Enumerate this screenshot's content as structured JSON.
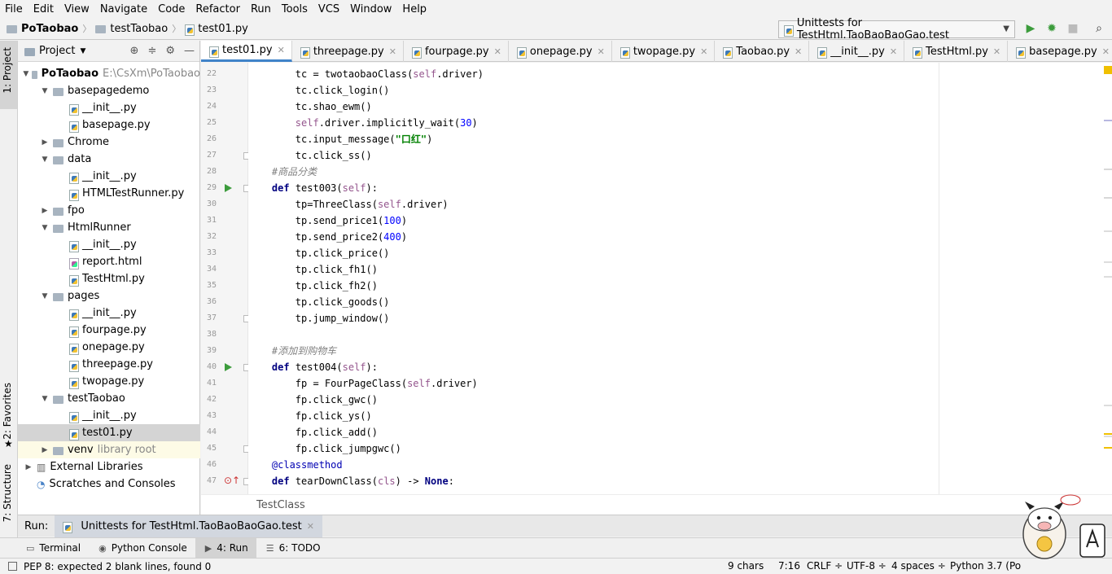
{
  "menu": [
    "File",
    "Edit",
    "View",
    "Navigate",
    "Code",
    "Refactor",
    "Run",
    "Tools",
    "VCS",
    "Window",
    "Help"
  ],
  "nav": {
    "project": "PoTaobao",
    "folder": "testTaobao",
    "file": "test01.py"
  },
  "run_config": "Unittests for TestHtml.TaoBaoBaoGao.test",
  "side_tabs": {
    "project": "1: Project",
    "favorites": "2: Favorites",
    "structure": "7: Structure"
  },
  "project_panel": {
    "title": "Project",
    "tree": [
      {
        "label": "PoTaobao",
        "extra": "E:\\CsXm\\PoTaobao",
        "kind": "folder",
        "depth": 0,
        "expanded": true,
        "bold": true
      },
      {
        "label": "basepagedemo",
        "kind": "folder",
        "depth": 1,
        "expanded": true
      },
      {
        "label": "__init__.py",
        "kind": "py",
        "depth": 2
      },
      {
        "label": "basepage.py",
        "kind": "py",
        "depth": 2
      },
      {
        "label": "Chrome",
        "kind": "folder",
        "depth": 1,
        "expanded": false
      },
      {
        "label": "data",
        "kind": "folder",
        "depth": 1,
        "expanded": true
      },
      {
        "label": "__init__.py",
        "kind": "py",
        "depth": 2
      },
      {
        "label": "HTMLTestRunner.py",
        "kind": "py",
        "depth": 2
      },
      {
        "label": "fpo",
        "kind": "folder",
        "depth": 1,
        "expanded": false
      },
      {
        "label": "HtmlRunner",
        "kind": "folder",
        "depth": 1,
        "expanded": true
      },
      {
        "label": "__init__.py",
        "kind": "py",
        "depth": 2
      },
      {
        "label": "report.html",
        "kind": "html",
        "depth": 2
      },
      {
        "label": "TestHtml.py",
        "kind": "py",
        "depth": 2
      },
      {
        "label": "pages",
        "kind": "folder",
        "depth": 1,
        "expanded": true
      },
      {
        "label": "__init__.py",
        "kind": "py",
        "depth": 2
      },
      {
        "label": "fourpage.py",
        "kind": "py",
        "depth": 2
      },
      {
        "label": "onepage.py",
        "kind": "py",
        "depth": 2
      },
      {
        "label": "threepage.py",
        "kind": "py",
        "depth": 2
      },
      {
        "label": "twopage.py",
        "kind": "py",
        "depth": 2
      },
      {
        "label": "testTaobao",
        "kind": "folder",
        "depth": 1,
        "expanded": true
      },
      {
        "label": "__init__.py",
        "kind": "py",
        "depth": 2
      },
      {
        "label": "test01.py",
        "kind": "py",
        "depth": 2,
        "selected": true
      },
      {
        "label": "venv",
        "extra": "library root",
        "kind": "folder",
        "depth": 1,
        "expanded": false,
        "venv": true
      },
      {
        "label": "External Libraries",
        "kind": "lib",
        "depth": 0,
        "expanded": false
      },
      {
        "label": "Scratches and Consoles",
        "kind": "scratch",
        "depth": 0
      }
    ]
  },
  "editor_tabs": [
    "test01.py",
    "threepage.py",
    "fourpage.py",
    "onepage.py",
    "twopage.py",
    "Taobao.py",
    "__init__.py",
    "TestHtml.py",
    "basepage.py"
  ],
  "code": [
    {
      "n": "22",
      "t": "        tc = twotaobaoClass(self.driver)"
    },
    {
      "n": "23",
      "t": "        tc.click_login()"
    },
    {
      "n": "24",
      "t": "        tc.shao_ewm()"
    },
    {
      "n": "25",
      "t": "        self.driver.implicitly_wait(30)"
    },
    {
      "n": "26",
      "t": "        tc.input_message(\"口红\")"
    },
    {
      "n": "27",
      "t": "        tc.click_ss()",
      "fold": true
    },
    {
      "n": "28",
      "t": "    #商品分类"
    },
    {
      "n": "29",
      "t": "    def test003(self):",
      "run": true,
      "fold": true
    },
    {
      "n": "30",
      "t": "        tp=ThreeClass(self.driver)"
    },
    {
      "n": "31",
      "t": "        tp.send_price1(100)"
    },
    {
      "n": "32",
      "t": "        tp.send_price2(400)"
    },
    {
      "n": "33",
      "t": "        tp.click_price()"
    },
    {
      "n": "34",
      "t": "        tp.click_fh1()"
    },
    {
      "n": "35",
      "t": "        tp.click_fh2()"
    },
    {
      "n": "36",
      "t": "        tp.click_goods()"
    },
    {
      "n": "37",
      "t": "        tp.jump_window()",
      "fold": true
    },
    {
      "n": "38",
      "t": ""
    },
    {
      "n": "39",
      "t": "    #添加到购物车"
    },
    {
      "n": "40",
      "t": "    def test004(self):",
      "run": true,
      "fold": true
    },
    {
      "n": "41",
      "t": "        fp = FourPageClass(self.driver)"
    },
    {
      "n": "42",
      "t": "        fp.click_gwc()"
    },
    {
      "n": "43",
      "t": "        fp.click_ys()"
    },
    {
      "n": "44",
      "t": "        fp.click_add()"
    },
    {
      "n": "45",
      "t": "        fp.click_jumpgwc()",
      "fold": true
    },
    {
      "n": "46",
      "t": "    @classmethod"
    },
    {
      "n": "47",
      "t": "    def tearDownClass(cls) -> None:",
      "override": true,
      "fold": true
    }
  ],
  "code_context": "TestClass",
  "run_bar": {
    "label": "Run:",
    "tab": "Unittests for TestHtml.TaoBaoBaoGao.test"
  },
  "tool_windows": [
    {
      "label": "Terminal"
    },
    {
      "label": "Python Console"
    },
    {
      "label": "4: Run",
      "active": true
    },
    {
      "label": "6: TODO"
    }
  ],
  "status": {
    "message": "PEP 8: expected 2 blank lines, found 0",
    "chars": "9 chars",
    "position": "7:16",
    "line_sep": "CRLF ÷",
    "encoding": "UTF-8 ÷",
    "indent": "4 spaces ÷",
    "interpreter": "Python 3.7 (Po"
  },
  "colors": {
    "accent": "#4083c9",
    "keyword": "#000080",
    "self": "#94558d",
    "number": "#0000ff",
    "string": "#008000",
    "comment": "#808080",
    "run": "#3c9c3c"
  }
}
